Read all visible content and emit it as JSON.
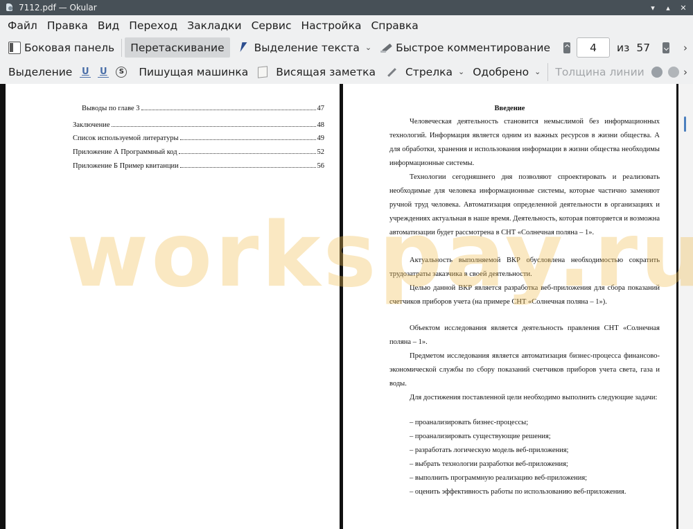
{
  "window": {
    "title": "7112.pdf  — Okular",
    "minimize": "▾",
    "maximize": "▴",
    "close": "✕"
  },
  "menu": [
    "Файл",
    "Правка",
    "Вид",
    "Переход",
    "Закладки",
    "Сервис",
    "Настройка",
    "Справка"
  ],
  "toolbar1": {
    "sidebar": "Боковая панель",
    "browse": "Перетаскивание",
    "text_select": "Выделение текста",
    "quick_annot": "Быстрое комментирование",
    "page_current": "4",
    "page_of": "из",
    "page_total": "57",
    "more": "›"
  },
  "toolbar2": {
    "highlight": "Выделение",
    "typewriter": "Пишущая машинка",
    "note": "Висящая заметка",
    "arrow": "Стрелка",
    "stamp": "Одобрено",
    "line_width": "Толщина линии",
    "more": "›"
  },
  "left_page": {
    "toc": [
      {
        "title": "Выводы по главе 3",
        "page": "47"
      },
      {
        "title": "Заключение",
        "page": "48"
      },
      {
        "title": "Список используемой литературы",
        "page": "49"
      },
      {
        "title": "Приложение А Программный код",
        "page": "52"
      },
      {
        "title": "Приложение Б Пример квитанции",
        "page": "56"
      }
    ]
  },
  "right_page": {
    "heading": "Введение",
    "paragraphs": [
      "Человеческая деятельность становится немыслимой без информационных технологий. Информация является одним из важных ресурсов в жизни общества. А для обработки, хранения и использования информации в жизни общества необходимы информационные системы.",
      "Технологии сегодняшнего дня позволяют спроектировать и реализовать необходимые для человека информационные системы, которые частично заменяют ручной труд человека. Автоматизация определенной деятельности в организациях и учреждениях актуальная в наше время. Деятельность, которая повторяется и возможна автоматизации будет рассмотрена в СНТ «Солнечная поляна – 1».",
      "Актуальность выполняемой ВКР обусловлена необходимостью сократить трудозатраты заказчика в своей деятельности.",
      "Целью данной ВКР является разработка веб-приложения для сбора показаний счетчиков приборов учета (на примере СНТ «Солнечная поляна – 1»).",
      "Объектом исследования является деятельность правления СНТ «Солнечная поляна – 1».",
      "Предметом исследования является автоматизация бизнес-процесса финансово-экономической службы по сбору показаний счетчиков приборов учета света, газа и воды.",
      "Для достижения поставленной цели необходимо выполнить следующие задачи:"
    ],
    "tasks": [
      "– проанализировать бизнес-процессы;",
      "– проанализировать существующие решения;",
      "– разработать логическую модель веб-приложения;",
      "– выбрать технологии разработки веб-приложения;",
      "– выполнить программную реализацию веб-приложения;",
      "– оценить эффективность работы по использованию веб-приложения."
    ]
  },
  "watermark": "workspay.ru",
  "colors": {
    "titlebar": "#475057",
    "toolbar": "#eff0f1",
    "pressed": "#d4d6d8",
    "watermark": "#f0bc50",
    "accent": "#4b7fbe"
  }
}
